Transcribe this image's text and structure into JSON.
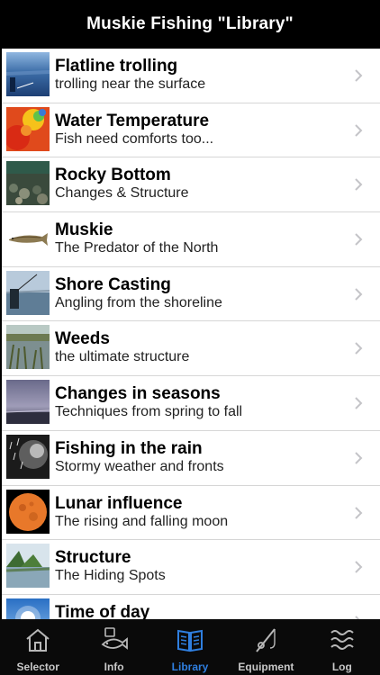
{
  "header": {
    "title": "Muskie Fishing \"Library\""
  },
  "list": {
    "items": [
      {
        "title": "Flatline trolling",
        "subtitle": "trolling near the surface",
        "thumb": "trolling-boat-image"
      },
      {
        "title": "Water Temperature",
        "subtitle": "Fish need comforts too...",
        "thumb": "temperature-map-image"
      },
      {
        "title": "Rocky Bottom",
        "subtitle": "Changes & Structure",
        "thumb": "rocky-bottom-image"
      },
      {
        "title": "Muskie",
        "subtitle": "The Predator of the North",
        "thumb": "muskie-fish-image"
      },
      {
        "title": "Shore Casting",
        "subtitle": "Angling from the shoreline",
        "thumb": "shore-casting-image"
      },
      {
        "title": "Weeds",
        "subtitle": "the ultimate structure",
        "thumb": "weeds-image"
      },
      {
        "title": "Changes in seasons",
        "subtitle": "Techniques from spring to fall",
        "thumb": "seasons-sky-image"
      },
      {
        "title": "Fishing in the rain",
        "subtitle": "Stormy weather and fronts",
        "thumb": "rain-image"
      },
      {
        "title": "Lunar influence",
        "subtitle": "The rising and falling moon",
        "thumb": "moon-image"
      },
      {
        "title": "Structure",
        "subtitle": "The Hiding Spots",
        "thumb": "structure-image"
      },
      {
        "title": "Time of day",
        "subtitle": "",
        "thumb": "time-of-day-image"
      }
    ]
  },
  "tabbar": {
    "tabs": [
      {
        "label": "Selector",
        "icon": "house-icon",
        "active": false
      },
      {
        "label": "Info",
        "icon": "fish-info-icon",
        "active": false
      },
      {
        "label": "Library",
        "icon": "book-icon",
        "active": true
      },
      {
        "label": "Equipment",
        "icon": "fishing-rod-icon",
        "active": false
      },
      {
        "label": "Log",
        "icon": "waves-log-icon",
        "active": false
      }
    ]
  },
  "colors": {
    "active_tab": "#2f7fe0",
    "inactive_tab": "#c8c8c8",
    "header_bg": "#000000"
  }
}
